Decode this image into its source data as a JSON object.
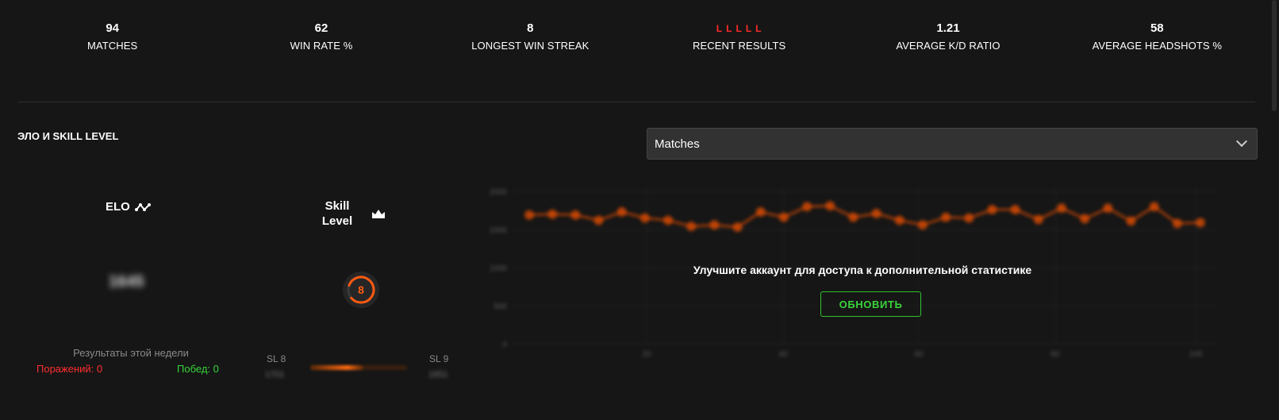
{
  "stats": [
    {
      "value": "94",
      "label": "MATCHES"
    },
    {
      "value": "62",
      "label": "WIN RATE %"
    },
    {
      "value": "8",
      "label": "LONGEST WIN STREAK"
    },
    {
      "value": "",
      "label": "RECENT RESULTS"
    },
    {
      "value": "1.21",
      "label": "AVERAGE K/D RATIO"
    },
    {
      "value": "58",
      "label": "AVERAGE HEADSHOTS %"
    }
  ],
  "recent_results": [
    "L",
    "L",
    "L",
    "L",
    "L"
  ],
  "section": {
    "title": "ЭЛО И SKILL LEVEL"
  },
  "dropdown": {
    "selected": "Matches"
  },
  "elo": {
    "label": "ELO",
    "value": "1645"
  },
  "skill": {
    "label_line1": "Skill",
    "label_line2": "Level",
    "level": "8"
  },
  "week": {
    "title": "Результаты этой недели",
    "losses": "Поражений: 0",
    "wins": "Побед: 0"
  },
  "skill_progress": {
    "left_label": "SL 8",
    "right_label": "SL 9",
    "left_value": "1701",
    "right_value": "1851",
    "progress": 0.55
  },
  "upgrade": {
    "message": "Улучшите аккаунт для доступа к дополнительной статистике",
    "button": "ОБНОВИТЬ"
  },
  "colors": {
    "accent": "#ff5500",
    "loss": "#ff2e2e",
    "win": "#38d63a",
    "background": "#161616"
  },
  "chart_data": {
    "type": "line",
    "ylim": [
      0,
      2000
    ],
    "yticks": [
      "0",
      "500",
      "1000",
      "1500",
      "2000"
    ],
    "xticks": [
      "20",
      "40",
      "60",
      "80",
      "100"
    ],
    "x": [
      1,
      2,
      3,
      4,
      5,
      6,
      7,
      8,
      9,
      10,
      11,
      12,
      13,
      14,
      15,
      16,
      17,
      18,
      19,
      20,
      21,
      22,
      23,
      24,
      25,
      26,
      27,
      28,
      29,
      30
    ],
    "values": [
      1690,
      1700,
      1690,
      1620,
      1730,
      1650,
      1620,
      1540,
      1560,
      1530,
      1730,
      1660,
      1800,
      1810,
      1660,
      1710,
      1620,
      1560,
      1660,
      1650,
      1760,
      1760,
      1630,
      1780,
      1640,
      1780,
      1610,
      1800,
      1580,
      1590
    ],
    "color": "#ff5500",
    "grid": true
  }
}
